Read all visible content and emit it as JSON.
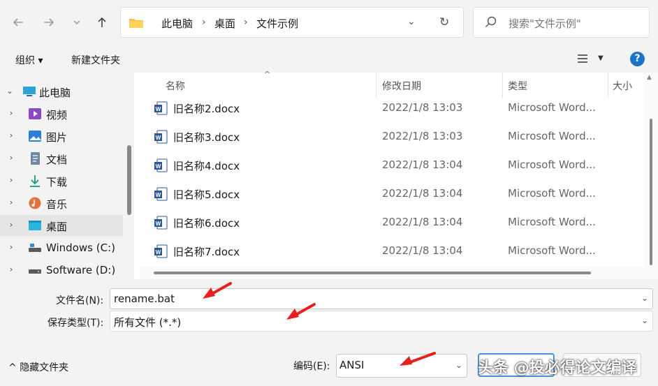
{
  "nav": {
    "back_icon": "arrow-left-icon",
    "forward_icon": "arrow-right-icon",
    "recent_icon": "chevron-down-icon",
    "up_icon": "arrow-up-icon"
  },
  "address": {
    "crumbs": [
      "此电脑",
      "桌面",
      "文件示例"
    ]
  },
  "search": {
    "placeholder": "搜索\"文件示例\""
  },
  "toolbar": {
    "organize_label": "组织 ▾",
    "new_folder_label": "新建文件夹",
    "help_label": "?"
  },
  "sidebar": {
    "items": [
      {
        "label": "此电脑",
        "icon": "computer-icon"
      },
      {
        "label": "视频",
        "icon": "video-icon"
      },
      {
        "label": "图片",
        "icon": "picture-icon"
      },
      {
        "label": "文档",
        "icon": "document-icon"
      },
      {
        "label": "下载",
        "icon": "download-icon"
      },
      {
        "label": "音乐",
        "icon": "music-icon"
      },
      {
        "label": "桌面",
        "icon": "desktop-icon"
      },
      {
        "label": "Windows (C:)",
        "icon": "drive-icon"
      },
      {
        "label": "Software (D:)",
        "icon": "drive-icon"
      }
    ]
  },
  "filelist": {
    "columns": [
      "名称",
      "修改日期",
      "类型",
      "大小"
    ],
    "rows": [
      {
        "name": "旧名称2.docx",
        "date": "2022/1/8 13:03",
        "type": "Microsoft Word..."
      },
      {
        "name": "旧名称3.docx",
        "date": "2022/1/8 13:03",
        "type": "Microsoft Word..."
      },
      {
        "name": "旧名称4.docx",
        "date": "2022/1/8 13:04",
        "type": "Microsoft Word..."
      },
      {
        "name": "旧名称5.docx",
        "date": "2022/1/8 13:04",
        "type": "Microsoft Word..."
      },
      {
        "name": "旧名称6.docx",
        "date": "2022/1/8 13:04",
        "type": "Microsoft Word..."
      },
      {
        "name": "旧名称7.docx",
        "date": "2022/1/8 13:04",
        "type": "Microsoft Word..."
      }
    ]
  },
  "form": {
    "filename_label": "文件名(N):",
    "filename_value": "rename.bat",
    "filetype_label": "保存类型(T):",
    "filetype_value": "所有文件 (*.*)"
  },
  "footer": {
    "hide_folders_label": "隐藏文件夹",
    "encoding_label": "编码(E):",
    "encoding_value": "ANSI"
  },
  "watermark": "头条 @投必得论文编译",
  "colors": {
    "accent": "#1a73c8",
    "annotation": "#e5201d",
    "selected": "#e5e5e5"
  }
}
